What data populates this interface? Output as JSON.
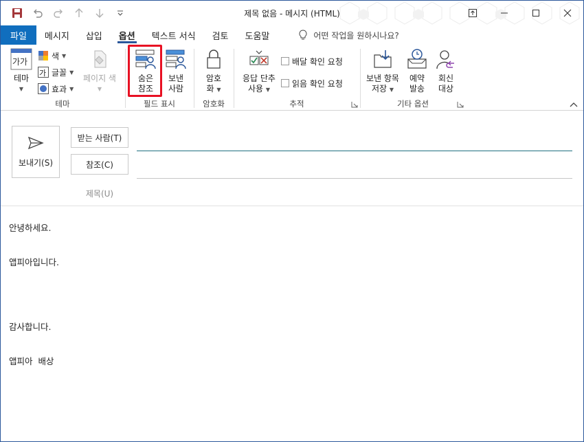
{
  "window": {
    "title": "제목 없음  -  메시지 (HTML)"
  },
  "tabs": [
    {
      "label": "파일"
    },
    {
      "label": "메시지"
    },
    {
      "label": "삽입"
    },
    {
      "label": "옵션"
    },
    {
      "label": "텍스트 서식"
    },
    {
      "label": "검토"
    },
    {
      "label": "도움말"
    }
  ],
  "tellme": {
    "placeholder": "어떤 작업을 원하시나요?"
  },
  "ribbon": {
    "theme_group": {
      "label": "테마",
      "theme_btn": "테마",
      "theme_icon_text": "가가",
      "colors": "색",
      "fonts": "글꼴",
      "fonts_icon_text": "가",
      "effects": "효과",
      "page_color": "페이지 색"
    },
    "fields_group": {
      "label": "필드 표시",
      "bcc_line1": "숨은",
      "bcc_line2": "참조",
      "from_line1": "보낸",
      "from_line2": "사람"
    },
    "encrypt_group": {
      "label": "암호화",
      "encrypt_line1": "암호",
      "encrypt_line2": "화"
    },
    "tracking_group": {
      "label": "추적",
      "voting_line1": "응답 단추",
      "voting_line2": "사용",
      "delivery_receipt": "배달 확인 요청",
      "read_receipt": "읽음 확인 요청"
    },
    "more_group": {
      "label": "기타 옵션",
      "save_line1": "보낸 항목",
      "save_line2": "저장",
      "delay_line1": "예약",
      "delay_line2": "발송",
      "reply_line1": "회신",
      "reply_line2": "대상"
    }
  },
  "compose": {
    "send": "보내기(S)",
    "to": "받는 사람(T)",
    "cc": "참조(C)",
    "subject": "제목(U)"
  },
  "body": {
    "line1": "안녕하세요.",
    "line2": "앱피아입니다.",
    "line3": "감사합니다.",
    "line4": "앱피아  배상"
  },
  "colors": {
    "accent": "#2b579a",
    "file_tab": "#106ebe",
    "highlight": "#e81123"
  }
}
